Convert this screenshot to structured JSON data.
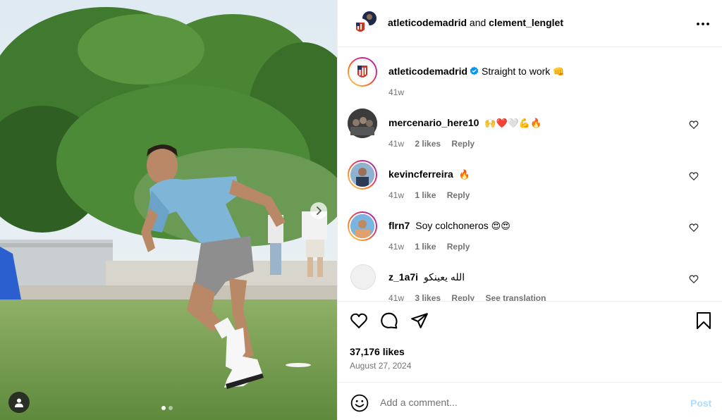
{
  "header": {
    "account": "atleticodemadrid",
    "connector": "and",
    "collaborator": "clement_lenglet",
    "more_icon": "ellipsis-icon"
  },
  "caption": {
    "user": "atleticodemadrid",
    "verified": true,
    "text": "Straight to work",
    "emoji": "👊",
    "time": "41w"
  },
  "comments": [
    {
      "user": "mercenario_here10",
      "text": "",
      "emoji": "🙌❤️🤍💪🔥",
      "time": "41w",
      "likes": "2 likes",
      "reply": "Reply",
      "translation": ""
    },
    {
      "user": "kevincferreira",
      "text": "",
      "emoji": "🔥",
      "time": "41w",
      "likes": "1 like",
      "reply": "Reply",
      "translation": ""
    },
    {
      "user": "flrn7",
      "text": "Soy colchoneros",
      "emoji": "😍😍",
      "time": "41w",
      "likes": "1 like",
      "reply": "Reply",
      "translation": ""
    },
    {
      "user": "z_1a7i",
      "text": "الله يعينكو",
      "emoji": "",
      "time": "41w",
      "likes": "3 likes",
      "reply": "Reply",
      "translation": "See translation"
    }
  ],
  "stats": {
    "likes": "37,176 likes",
    "date": "August 27, 2024"
  },
  "composer": {
    "placeholder": "Add a comment...",
    "post_label": "Post"
  },
  "colors": {
    "verified": "#0095f6",
    "post_disabled": "#b3dbff",
    "meta": "#737373",
    "club_red": "#cb3524",
    "club_blue": "#272e61"
  },
  "carousel": {
    "slide": 1,
    "total": 2
  }
}
